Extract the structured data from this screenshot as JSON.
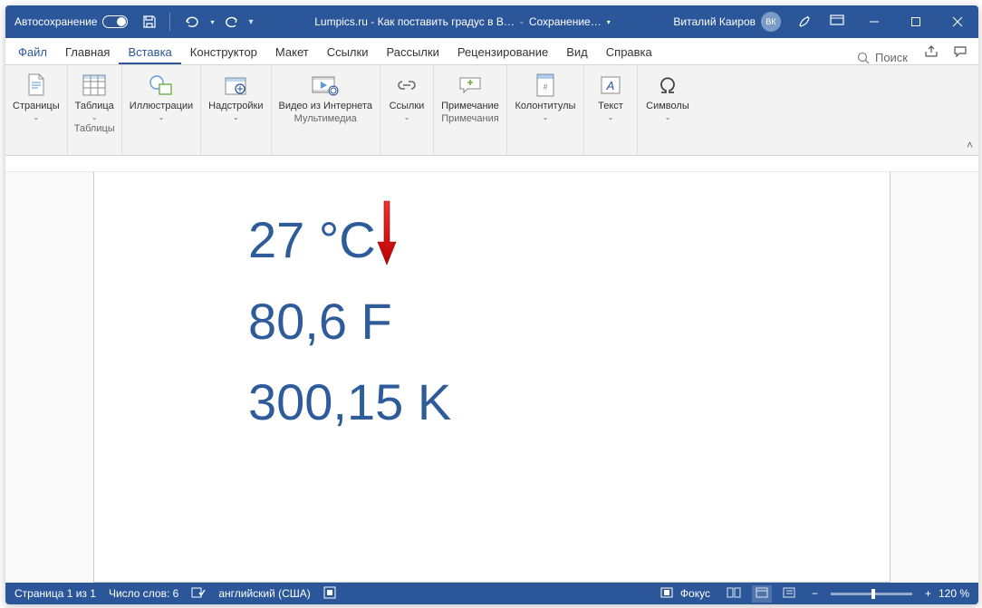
{
  "title": {
    "autosave": "Автосохранение",
    "docname": "Lumpics.ru - Как поставить градус в B…",
    "saving": "Сохранение…",
    "user": "Виталий Каиров",
    "initials": "ВК"
  },
  "tabs": {
    "file": "Файл",
    "home": "Главная",
    "insert": "Вставка",
    "design": "Конструктор",
    "layout": "Макет",
    "references": "Ссылки",
    "mailings": "Рассылки",
    "review": "Рецензирование",
    "view": "Вид",
    "help": "Справка",
    "search": "Поиск"
  },
  "ribbon": {
    "pages": "Страницы",
    "table": "Таблица",
    "tables_group": "Таблицы",
    "illustrations": "Иллюстрации",
    "addins": "Надстройки",
    "video": "Видео из Интернета",
    "media_group": "Мультимедиа",
    "links": "Ссылки",
    "comment": "Примечание",
    "comments_group": "Примечания",
    "hf": "Колонтитулы",
    "text": "Текст",
    "symbols": "Символы"
  },
  "document": {
    "line1": "27 °C",
    "line2": "80,6 F",
    "line3": "300,15 K"
  },
  "status": {
    "page": "Страница 1 из 1",
    "words": "Число слов: 6",
    "lang": "английский (США)",
    "focus": "Фокус",
    "zoom": "120 %"
  }
}
